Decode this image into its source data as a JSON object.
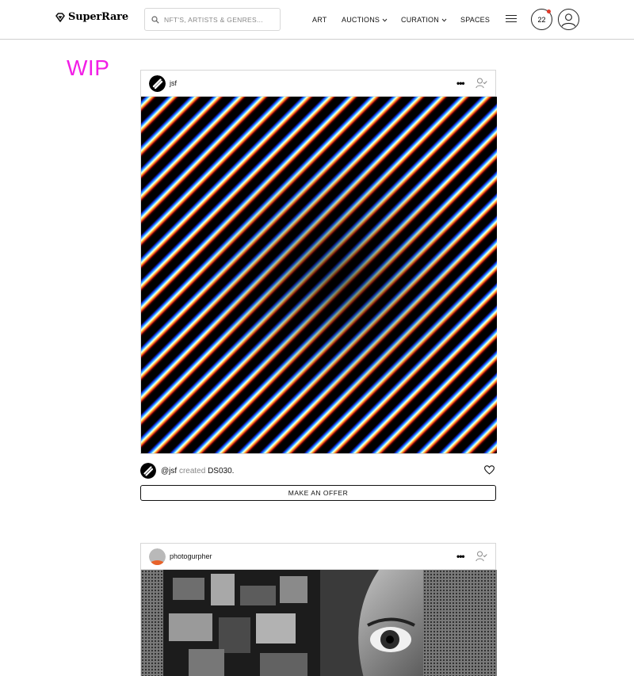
{
  "header": {
    "logo_text": "SuperRare",
    "search_placeholder": "NFT'S, ARTISTS & GENRES...",
    "nav": [
      {
        "label": "ART",
        "has_dropdown": false
      },
      {
        "label": "AUCTIONS",
        "has_dropdown": true
      },
      {
        "label": "CURATION",
        "has_dropdown": true
      },
      {
        "label": "SPACES",
        "has_dropdown": false
      }
    ],
    "notification_count": "22",
    "notification_dot_color": "#e23a2a"
  },
  "banner": {
    "text": "WIP",
    "color": "#f21ee6"
  },
  "posts": [
    {
      "username": "jsf",
      "more_label": "•••",
      "caption": {
        "handle": "@jsf",
        "verb": "created",
        "title": "DS030."
      },
      "offer_label": "MAKE AN OFFER"
    },
    {
      "username": "photogurpher",
      "more_label": "•••"
    }
  ],
  "icons": {
    "logo": "diamond-icon",
    "search": "search-icon",
    "menu": "hamburger-icon",
    "profile": "user-icon",
    "more": "more-dots-icon",
    "follow": "follow-user-icon",
    "like": "heart-icon"
  }
}
